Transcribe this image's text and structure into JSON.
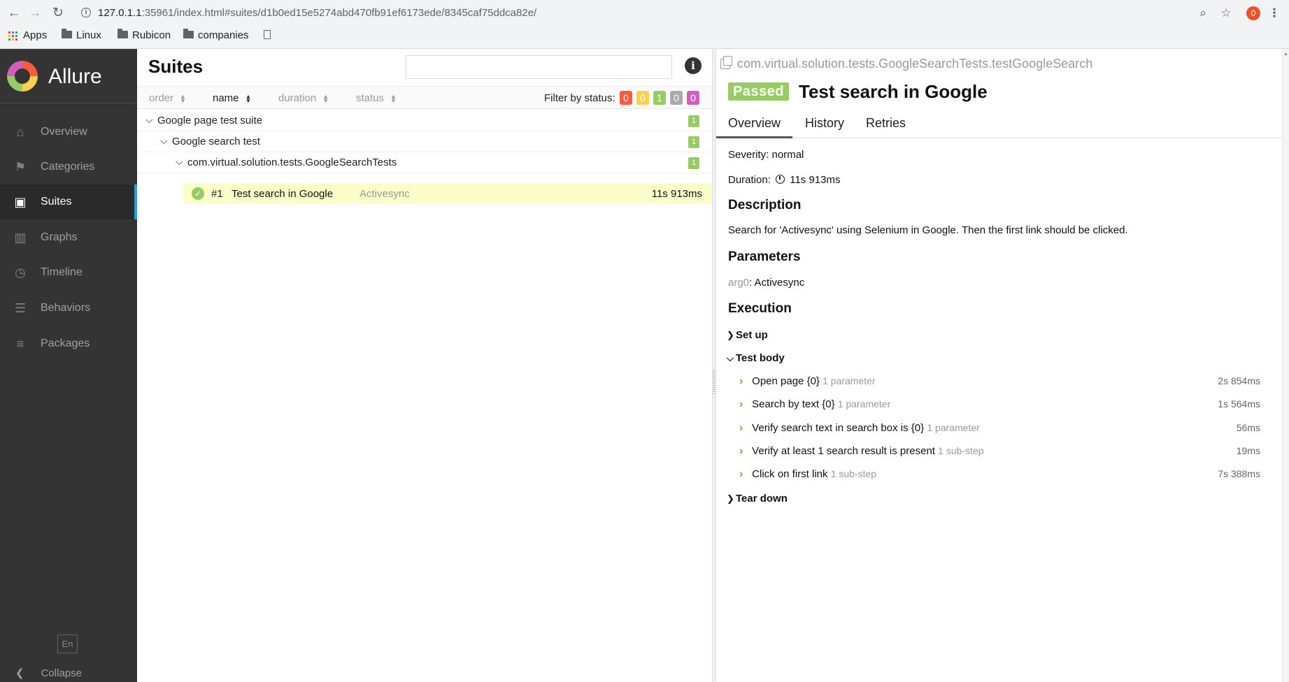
{
  "browser": {
    "url_host": "127.0.1.1",
    "url_rest": ":35961/index.html#suites/d1b0ed15e5274abd470fb91ef6173ede/8345caf75ddca82e/",
    "extension_badge": "0",
    "bookmarks": [
      {
        "label": "Apps",
        "icon": "apps-grid-icon"
      },
      {
        "label": "Linux",
        "icon": "folder-icon"
      },
      {
        "label": "Rubicon",
        "icon": "folder-icon"
      },
      {
        "label": "companies",
        "icon": "folder-icon"
      }
    ]
  },
  "sidebar": {
    "brand": "Allure",
    "items": [
      {
        "label": "Overview",
        "icon": "home-icon"
      },
      {
        "label": "Categories",
        "icon": "flag-icon"
      },
      {
        "label": "Suites",
        "icon": "briefcase-icon",
        "active": true
      },
      {
        "label": "Graphs",
        "icon": "bar-chart-icon"
      },
      {
        "label": "Timeline",
        "icon": "clock-icon"
      },
      {
        "label": "Behaviors",
        "icon": "list-icon"
      },
      {
        "label": "Packages",
        "icon": "align-left-icon"
      }
    ],
    "language": "En",
    "collapse": "Collapse"
  },
  "suites": {
    "title": "Suites",
    "search_placeholder": "",
    "sort_headers": [
      "order",
      "name",
      "duration",
      "status"
    ],
    "active_sort": "name",
    "filter_label": "Filter by status:",
    "status_filters": [
      {
        "status": "failed",
        "count": "0",
        "color": "#fd5a3e"
      },
      {
        "status": "broken",
        "count": "0",
        "color": "#ffd050"
      },
      {
        "status": "passed",
        "count": "1",
        "color": "#97cc64"
      },
      {
        "status": "skipped",
        "count": "0",
        "color": "#aaaaaa"
      },
      {
        "status": "unknown",
        "count": "0",
        "color": "#d35ebe"
      }
    ],
    "tree": [
      {
        "label": "Google page test suite",
        "count": "1"
      },
      {
        "label": "Google search test",
        "count": "1"
      },
      {
        "label": "com.virtual.solution.tests.GoogleSearchTests",
        "count": "1"
      }
    ],
    "test": {
      "number": "#1",
      "name": "Test search in Google",
      "param": "Activesync",
      "duration": "11s 913ms",
      "status": "passed"
    }
  },
  "detail": {
    "full_name": "com.virtual.solution.tests.GoogleSearchTests.testGoogleSearch",
    "status": "Passed",
    "title": "Test search in Google",
    "tabs": [
      "Overview",
      "History",
      "Retries"
    ],
    "active_tab": "Overview",
    "severity_label": "Severity:",
    "severity_value": "normal",
    "duration_label": "Duration:",
    "duration_value": "11s 913ms",
    "description_heading": "Description",
    "description": "Search for 'Activesync' using Selenium in Google. Then the first link should be clicked.",
    "parameters_heading": "Parameters",
    "param_name": "arg0",
    "param_value": "Activesync",
    "execution_heading": "Execution",
    "setup": "Set up",
    "test_body": "Test body",
    "teardown": "Tear down",
    "steps": [
      {
        "name": "Open page {0}",
        "meta": "1 parameter",
        "duration": "2s 854ms"
      },
      {
        "name": "Search by text {0}",
        "meta": "1 parameter",
        "duration": "1s 564ms"
      },
      {
        "name": "Verify search text in search box is {0}",
        "meta": "1 parameter",
        "duration": "56ms"
      },
      {
        "name": "Verify at least 1 search result is present",
        "meta": "1 sub-step",
        "duration": "19ms"
      },
      {
        "name": "Click on first link",
        "meta": "1 sub-step",
        "duration": "7s 388ms"
      }
    ]
  },
  "colors": {
    "passed": "#97cc64",
    "sidebar_bg": "#343434",
    "active_accent": "#2d9ae9",
    "selected_row": "#fcfdc8"
  }
}
